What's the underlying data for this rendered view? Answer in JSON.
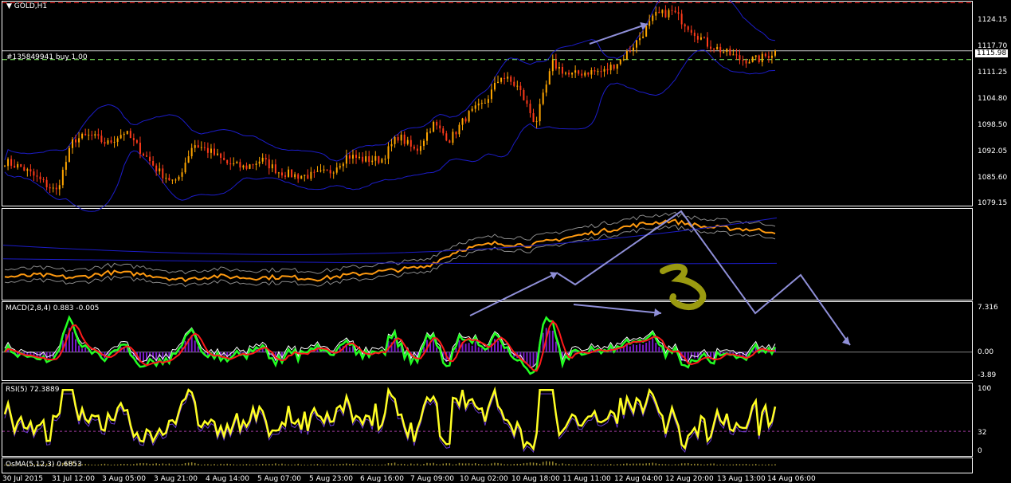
{
  "window": {
    "symbol_label": "GOLD,H1",
    "order_label": "#135849941 buy 1.00",
    "current_price": "1115.98",
    "colors": {
      "background": "#000000",
      "grid_frame": "#ffffff",
      "bollinger": "#1c1cc8",
      "candle_up": "#ffa500",
      "candle_down": "#ff3a1a",
      "order_line": "#c8c8c8",
      "dashed_red": "#ff2020",
      "dashed_green": "#8aff6a",
      "macd_green": "#22ff22",
      "macd_red": "#ff1a1a",
      "macd_hist": "#7a1cc8",
      "rsi_yellow": "#ffff22",
      "ma_orange": "#ff9a10",
      "annotation_arrow": "#8f8fd8",
      "annotation_marker": "#9a9a10"
    }
  },
  "chart_data": [
    {
      "type": "candlestick",
      "panel": "main",
      "title": "GOLD,H1",
      "y_ticks": [
        "1124.15",
        "1117.70",
        "1111.25",
        "1104.80",
        "1098.50",
        "1092.05",
        "1085.60",
        "1079.15"
      ],
      "ylim": [
        1077.5,
        1128.5
      ],
      "order_line_price": 1116.2,
      "take_profit_price": 1128.2,
      "stop_price": 1114.0,
      "close_trend": [
        1088.5,
        1087,
        1084,
        1081,
        1094,
        1095,
        1093,
        1096,
        1091,
        1086,
        1083,
        1093,
        1091,
        1088,
        1087,
        1089,
        1086,
        1085,
        1085,
        1086,
        1090,
        1089,
        1089,
        1095,
        1091,
        1098,
        1094,
        1100,
        1103,
        1110,
        1107,
        1098,
        1113,
        1110,
        1111,
        1111,
        1114,
        1119,
        1125,
        1126,
        1122,
        1118,
        1116,
        1114,
        1114,
        1116
      ]
    },
    {
      "type": "line",
      "panel": "moving-averages",
      "series": [
        {
          "values": [
            0.25,
            0.27,
            0.24,
            0.3,
            0.28,
            0.22,
            0.26,
            0.24,
            0.25,
            0.23,
            0.28,
            0.32,
            0.36,
            0.55,
            0.62,
            0.6,
            0.68,
            0.75,
            0.82,
            0.87,
            0.8,
            0.78,
            0.75
          ]
        }
      ]
    },
    {
      "type": "line",
      "panel": "macd",
      "title": "MACD(2,8,4) 0.883 -0.005",
      "y_ticks": [
        "7.316",
        "0.00",
        "-3.89"
      ],
      "ylim": [
        -4.5,
        8
      ]
    },
    {
      "type": "line",
      "panel": "rsi",
      "title": "RSI(5) 72.3889",
      "y_ticks": [
        "100",
        "32",
        "0"
      ],
      "ylim": [
        0,
        100
      ],
      "level": 32
    },
    {
      "type": "bar",
      "panel": "osma",
      "title": "OsMA(5,12,3) 0.6853"
    }
  ],
  "x_axis": {
    "labels": [
      "30 Jul 2015",
      "31 Jul 12:00",
      "3 Aug 05:00",
      "3 Aug 21:00",
      "4 Aug 14:00",
      "5 Aug 07:00",
      "5 Aug 23:00",
      "6 Aug 16:00",
      "7 Aug 09:00",
      "10 Aug 02:00",
      "10 Aug 18:00",
      "11 Aug 11:00",
      "12 Aug 04:00",
      "12 Aug 20:00",
      "13 Aug 13:00",
      "14 Aug 06:00"
    ]
  }
}
